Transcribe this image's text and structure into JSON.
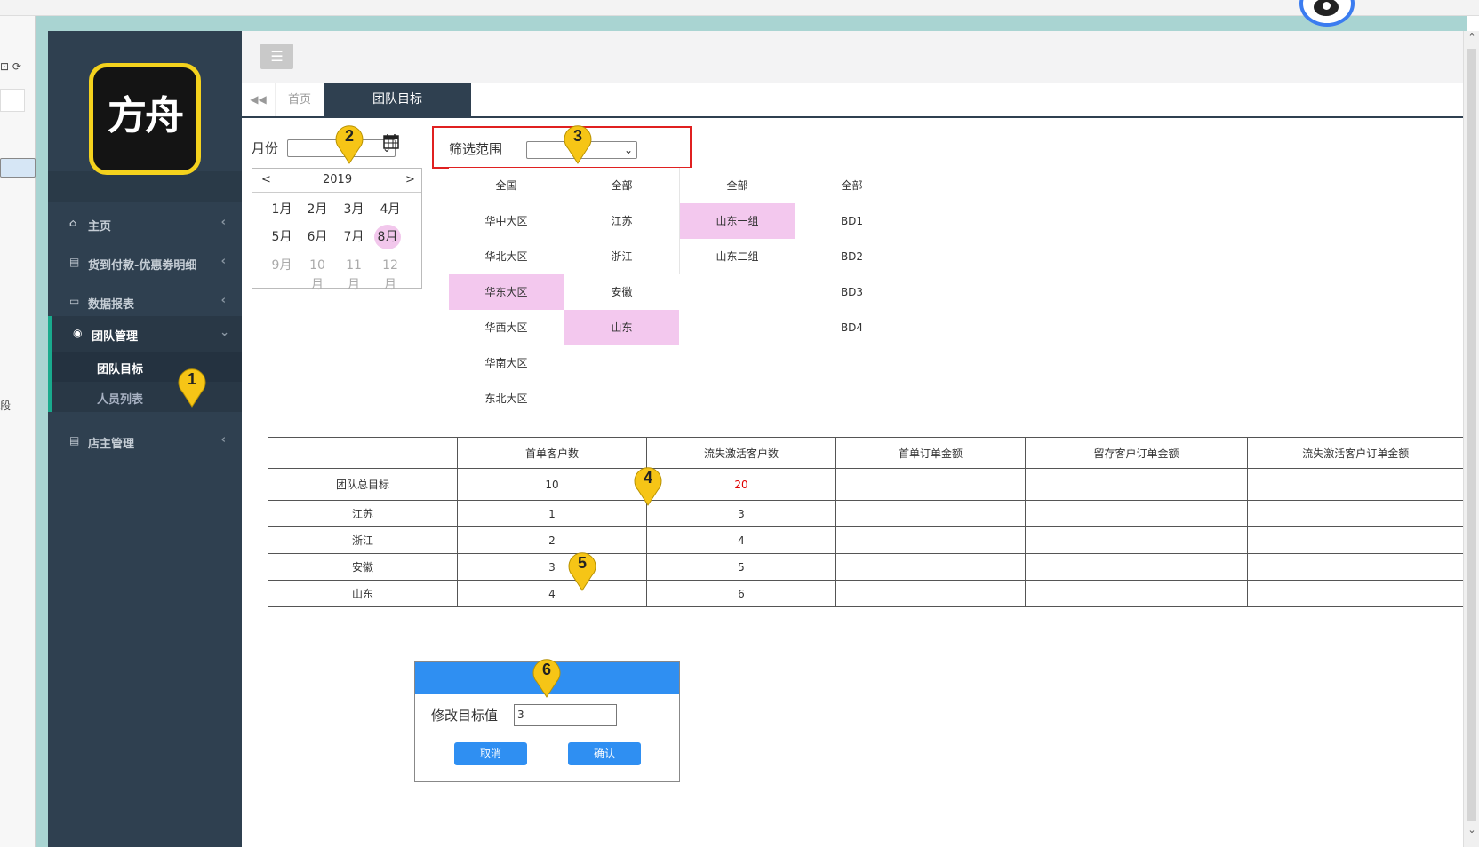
{
  "sidebar": {
    "logo_text": "方舟",
    "items": [
      {
        "label": "主页",
        "icon": "home-icon"
      },
      {
        "label": "货到付款-优惠劵明细",
        "icon": "bank-icon"
      },
      {
        "label": "数据报表",
        "icon": "report-icon"
      },
      {
        "label": "团队管理",
        "icon": "users-icon"
      },
      {
        "label": "店主管理",
        "icon": "idcard-icon"
      }
    ],
    "sub_items": [
      {
        "label": "团队目标"
      },
      {
        "label": "人员列表"
      }
    ]
  },
  "left_gutter": {
    "text": "段",
    "icons": "⊡ ⟳"
  },
  "header": {
    "menu_icon": "hamburger-icon",
    "tabs": {
      "home": "首页",
      "active": "团队目标"
    }
  },
  "filters": {
    "month_label": "月份",
    "range_label": "筛选范围",
    "month_value": "",
    "range_value": ""
  },
  "calendar": {
    "prev": "<",
    "year": "2019",
    "next": ">",
    "months": [
      "1月",
      "2月",
      "3月",
      "4月",
      "5月",
      "6月",
      "7月",
      "8月",
      "9月",
      "10月",
      "11月",
      "12月"
    ],
    "selected": "8月",
    "disabled": [
      "9月",
      "10月",
      "11月",
      "12月"
    ]
  },
  "cascader": {
    "regions": [
      "全国",
      "华中大区",
      "华北大区",
      "华东大区",
      "华西大区",
      "华南大区",
      "东北大区"
    ],
    "provinces": [
      "全部",
      "江苏",
      "浙江",
      "安徽",
      "山东"
    ],
    "groups": [
      "全部",
      "山东一组",
      "山东二组"
    ],
    "bds": [
      "全部",
      "BD1",
      "BD2",
      "BD3",
      "BD4"
    ],
    "selected": {
      "region": "华东大区",
      "province": "山东",
      "group": "山东一组"
    }
  },
  "table": {
    "headers": [
      "",
      "首单客户数",
      "流失激活客户数",
      "首单订单金额",
      "留存客户订单金额",
      "流失激活客户订单金额"
    ],
    "total_row": {
      "label": "团队总目标",
      "first_orders": "10",
      "reactivated": "20"
    },
    "rows": [
      {
        "label": "江苏",
        "first_orders": "1",
        "reactivated": "3"
      },
      {
        "label": "浙江",
        "first_orders": "2",
        "reactivated": "4"
      },
      {
        "label": "安徽",
        "first_orders": "3",
        "reactivated": "5"
      },
      {
        "label": "山东",
        "first_orders": "4",
        "reactivated": "6"
      }
    ]
  },
  "modal": {
    "field_label": "修改目标值",
    "field_value": "3",
    "cancel": "取消",
    "confirm": "确认"
  },
  "annotations": [
    "1",
    "2",
    "3",
    "4",
    "5",
    "6"
  ],
  "colors": {
    "sidebar": "#2f4050",
    "accent": "#19aa8d",
    "highlight": "#f3c8ee",
    "primary": "#2f8ff2",
    "pin": "#f6c516",
    "filter_border": "#e02020"
  }
}
